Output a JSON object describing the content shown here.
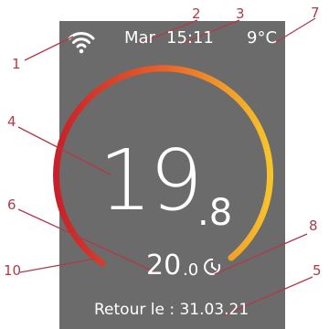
{
  "status_bar": {
    "day": "Mar",
    "time": "15:11",
    "outdoor_temp": "9°C",
    "wifi_icon": "wifi-icon"
  },
  "main": {
    "current_temp_whole": "19",
    "current_temp_decimal": ".8",
    "setpoint_whole": "20",
    "setpoint_decimal": ".0",
    "timer_icon": "timer-icon",
    "return_label": "Retour le : 31.03.21"
  },
  "ring": {
    "color_start": "#c8202a",
    "color_mid": "#e8622a",
    "color_end": "#f7c42a",
    "track_color": "#a0a0a0"
  },
  "callouts": {
    "c1": "1",
    "c2": "2",
    "c3": "3",
    "c4": "4",
    "c5": "5",
    "c6": "6",
    "c7": "7",
    "c8": "8",
    "c10": "10",
    "line_color": "#b03a48"
  }
}
